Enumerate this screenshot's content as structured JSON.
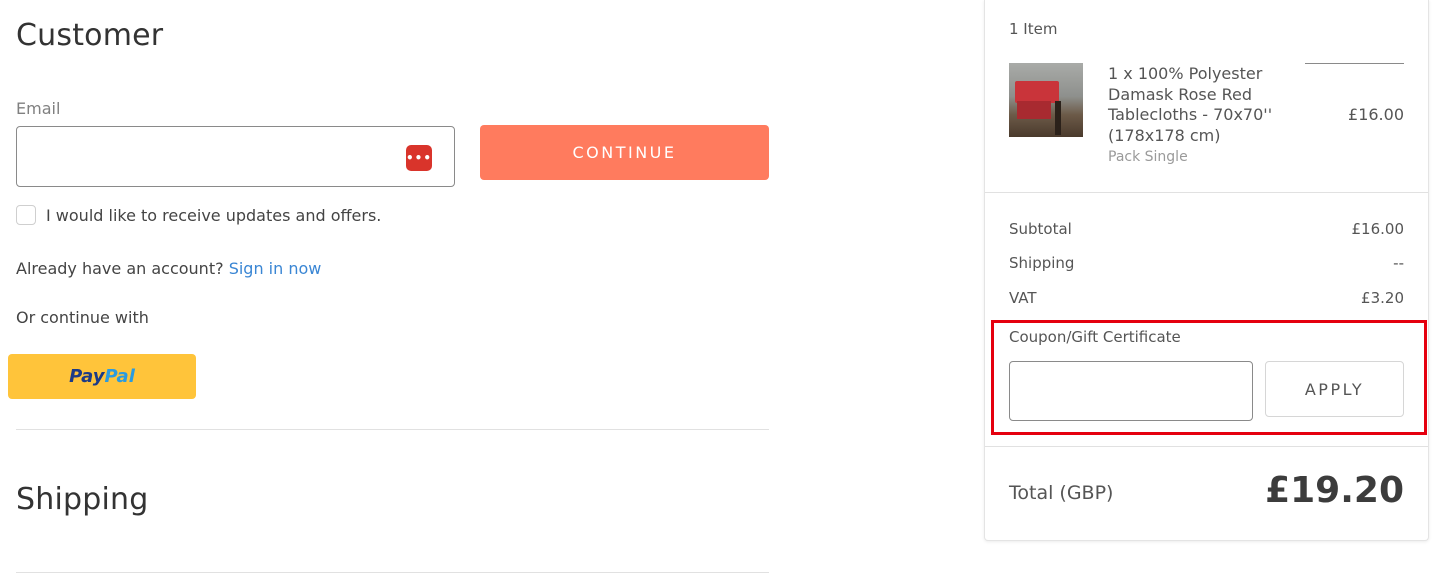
{
  "customer": {
    "title": "Customer",
    "email_label": "Email",
    "email_value": "",
    "password_manager_icon": "password-manager-icon",
    "continue_label": "CONTINUE",
    "updates_label": "I would like to receive updates and offers.",
    "account_prompt": "Already have an account?",
    "sign_in_label": "Sign in now",
    "or_continue": "Or continue with",
    "paypal_part1": "Pay",
    "paypal_part2": "Pal"
  },
  "shipping": {
    "title": "Shipping"
  },
  "summary": {
    "item_count": "1 Item",
    "item": {
      "name": "1 x 100% Polyester Damask Rose Red Tablecloths - 70x70'' (178x178 cm)",
      "variant": "Pack Single",
      "price": "£16.00"
    },
    "subtotal_label": "Subtotal",
    "subtotal_value": "£16.00",
    "shipping_label": "Shipping",
    "shipping_value": "--",
    "vat_label": "VAT",
    "vat_value": "£3.20",
    "coupon_label": "Coupon/Gift Certificate",
    "coupon_value": "",
    "apply_label": "APPLY",
    "total_label": "Total (GBP)",
    "total_value": "£19.20"
  },
  "colors": {
    "accent": "#ff7b5e",
    "link": "#3a86d4",
    "paypal": "#ffc43a",
    "highlight": "#e5000f"
  }
}
